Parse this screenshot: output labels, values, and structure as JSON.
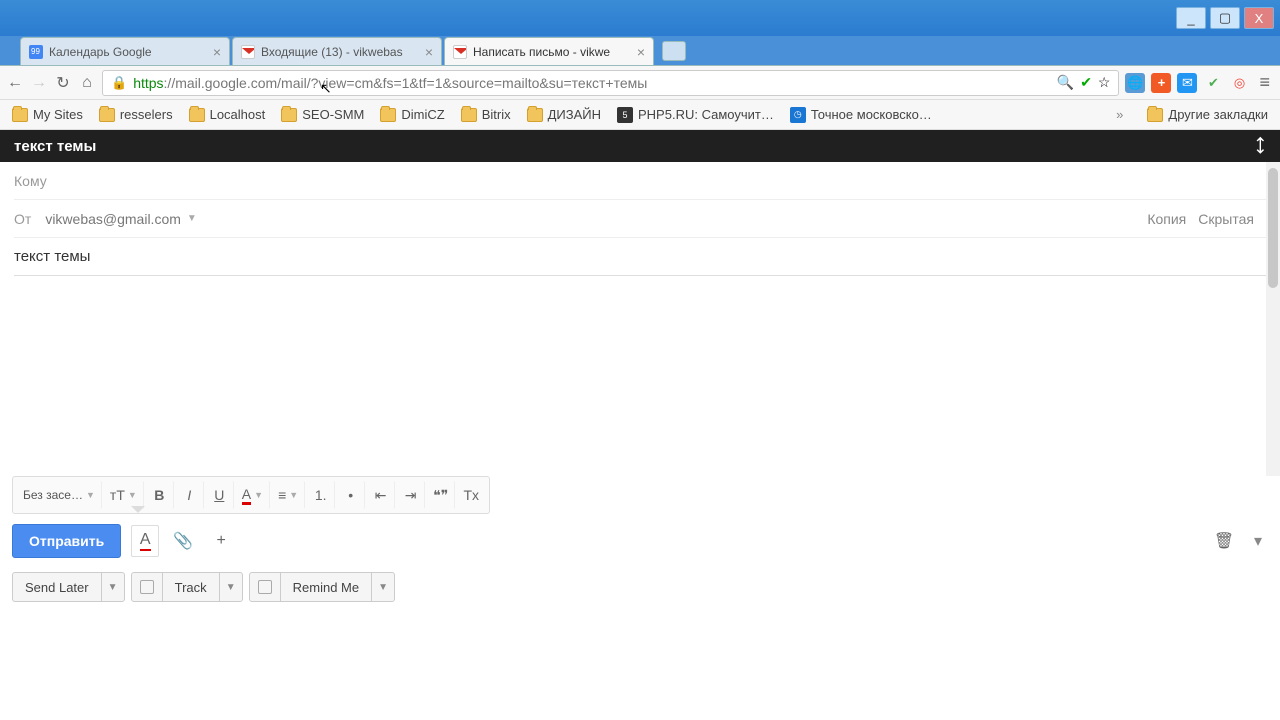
{
  "window": {
    "minimize": "_",
    "maximize": "▢",
    "close": "X"
  },
  "tabs": [
    {
      "label": "Календарь Google",
      "icon": "google"
    },
    {
      "label": "Входящие (13) - vikwebas",
      "icon": "gmail"
    },
    {
      "label": "Написать письмо - vikwe",
      "icon": "gmail",
      "active": true
    }
  ],
  "newtab": "+",
  "nav": {
    "back": "←",
    "forward": "→",
    "reload": "↻",
    "home": "⌂"
  },
  "omnibox": {
    "secure_part": "https",
    "rest": "://mail.google.com/mail/?view=cm&fs=1&tf=1&source=mailto&su=текст+темы",
    "zoom": "🔍",
    "ok": "✔",
    "star": "☆"
  },
  "ext": {
    "translate": "🌐",
    "plus": "+",
    "mail": "✉",
    "check": "✔",
    "target": "◎",
    "menu": "≡"
  },
  "bookmarks": [
    {
      "t": "folder",
      "label": "My Sites"
    },
    {
      "t": "folder",
      "label": "resselers"
    },
    {
      "t": "folder",
      "label": "Localhost"
    },
    {
      "t": "folder",
      "label": "SEO-SMM"
    },
    {
      "t": "folder",
      "label": "DimiCZ"
    },
    {
      "t": "folder",
      "label": "Bitrix"
    },
    {
      "t": "folder",
      "label": "ДИЗАЙН"
    },
    {
      "t": "site",
      "label": "PHP5.RU: Самоучит…",
      "badge": "5"
    },
    {
      "t": "site",
      "label": "Точное московско…",
      "badge": "◷"
    }
  ],
  "bookmarks_overflow": "»",
  "bookmarks_other": "Другие закладки",
  "compose": {
    "title": "текст темы",
    "expand": "⤡",
    "to_label": "Кому",
    "from_label": "От",
    "from_email": "vikwebas@gmail.com",
    "cc": "Копия",
    "bcc": "Скрытая",
    "subject": "текст темы"
  },
  "fmt": {
    "font": "Без засе…",
    "size": "тT",
    "bold": "B",
    "italic": "I",
    "underline": "U",
    "color": "A",
    "align": "≡",
    "ol": "1.",
    "ul": "•",
    "outdent": "⇤",
    "indent": "⇥",
    "quote": "❝❞",
    "clear": "Tx"
  },
  "send": {
    "button": "Отправить",
    "format": "A",
    "attach": "📎",
    "insert": "+",
    "trash": "🗑",
    "more": "▾"
  },
  "plugin": {
    "send_later": "Send Later",
    "track": "Track",
    "remind": "Remind Me"
  }
}
